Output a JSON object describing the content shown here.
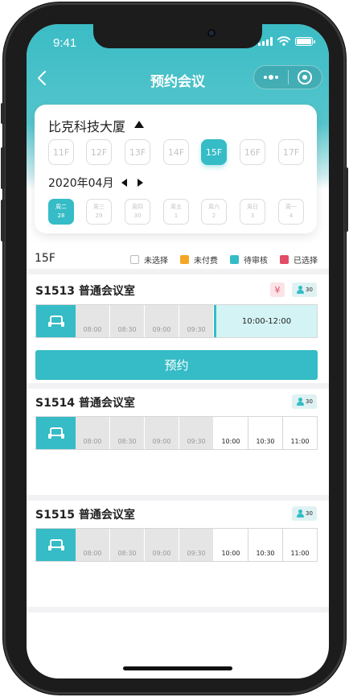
{
  "status_bar": {
    "time": "9:41"
  },
  "navbar": {
    "back_icon": "chevron-left-icon",
    "title": "预约会议"
  },
  "selector": {
    "building": "比克科技大厦",
    "floors": [
      "11F",
      "12F",
      "13F",
      "14F",
      "15F",
      "16F",
      "17F"
    ],
    "active_floor": "15F",
    "month": "2020年04月",
    "days": [
      {
        "weekday": "周二",
        "date": "28"
      },
      {
        "weekday": "周三",
        "date": "29"
      },
      {
        "weekday": "周四",
        "date": "30"
      },
      {
        "weekday": "周五",
        "date": "1"
      },
      {
        "weekday": "周六",
        "date": "2"
      },
      {
        "weekday": "周日",
        "date": "3"
      },
      {
        "weekday": "周一",
        "date": "4"
      }
    ],
    "active_day_index": 0
  },
  "legend": {
    "floor": "15F",
    "items": [
      {
        "label": "未选择",
        "color": "#ffffff"
      },
      {
        "label": "未付费",
        "color": "#f5a623"
      },
      {
        "label": "待审核",
        "color": "#35bcc6"
      },
      {
        "label": "已选择",
        "color": "#e14d67"
      }
    ]
  },
  "rooms": [
    {
      "name": "S1513 普通会议室",
      "paid_badge": "¥",
      "capacity": "30",
      "slots": [
        "08:00",
        "08:30",
        "09:00",
        "09:30"
      ],
      "selected_range": "10:00-12:00",
      "book_label": "预约"
    },
    {
      "name": "S1514 普通会议室",
      "capacity": "30",
      "slots": [
        "08:00",
        "08:30",
        "09:00",
        "09:30",
        "10:00",
        "10:30",
        "11:00"
      ]
    },
    {
      "name": "S1515 普通会议室",
      "capacity": "30",
      "slots": [
        "08:00",
        "08:30",
        "09:00",
        "09:30",
        "10:00",
        "10:30",
        "11:00"
      ]
    }
  ],
  "colors": {
    "accent": "#35bcc6",
    "unpaid": "#f5a623",
    "selected": "#e14d67"
  }
}
